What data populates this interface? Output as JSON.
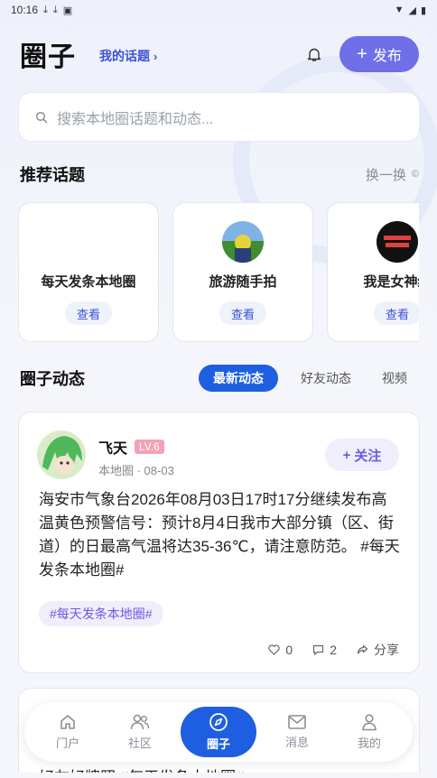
{
  "status_bar": {
    "time": "10:16"
  },
  "header": {
    "title": "圈子",
    "my_topics": "我的话题",
    "publish_label": "发布"
  },
  "search": {
    "placeholder": "搜索本地圈话题和动态..."
  },
  "recommended": {
    "title": "推荐话题",
    "refresh": "换一换",
    "topics": [
      {
        "name": "每天发条本地圈",
        "action": "查看"
      },
      {
        "name": "旅游随手拍",
        "action": "查看"
      },
      {
        "name": "我是女神经",
        "action": "查看"
      }
    ]
  },
  "feed": {
    "title": "圈子动态",
    "tabs": [
      "最新动态",
      "好友动态",
      "视频"
    ],
    "active_tab": 0
  },
  "post": {
    "username": "飞天",
    "level": "LV.6",
    "meta": "本地圈 · 08-03",
    "follow_label": "关注",
    "content": "海安市气象台2026年08月03日17时17分继续发布高温黄色预警信号：预计8月4日我市大部分镇（区、街道）的日最高气温将达35-36℃，请注意防范。 #每天发条本地圈#",
    "tag": "#每天发条本地圈#",
    "likes": "0",
    "comments": "2",
    "share": "分享"
  },
  "post2": {
    "content": "好友好牌照 #每天发条本地圈#"
  },
  "nav": {
    "items": [
      "门户",
      "社区",
      "圈子",
      "消息",
      "我的"
    ],
    "active": 2
  },
  "colors": {
    "accent": "#1d5fe0",
    "publish": "#6f6fe8",
    "link": "#3b52d6"
  }
}
